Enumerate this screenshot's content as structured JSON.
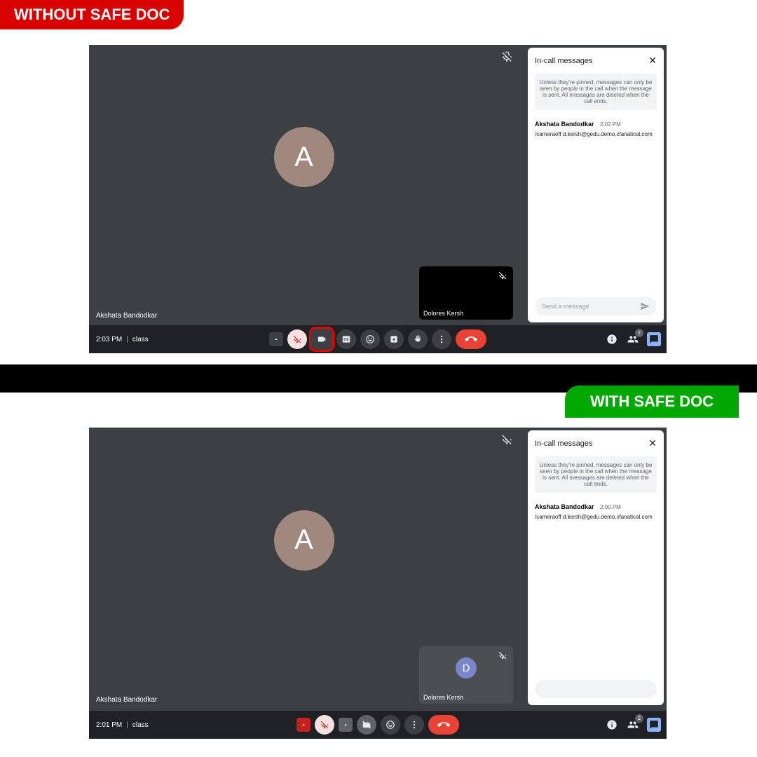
{
  "labels": {
    "without": "WITHOUT SAFE DOC",
    "with": "WITH SAFE DOC"
  },
  "shot1": {
    "avatar_letter": "A",
    "presenter": "Akshata Bandodkar",
    "self_view_name": "Dolores Kersh",
    "time": "2:03 PM",
    "room": "class",
    "chat": {
      "title": "In-call messages",
      "notice": "Unless they're pinned, messages can only be seen by people in the call when the message is sent. All messages are deleted when the call ends.",
      "author": "Akshata Bandodkar",
      "msg_time": "2:02 PM",
      "body": "/cameraoff d.kersh@gedu.demo.xfanatical.com",
      "placeholder": "Send a message"
    },
    "participants": "2"
  },
  "shot2": {
    "avatar_letter": "A",
    "presenter": "Akshata Bandodkar",
    "self_view_name": "Dolores Kersh",
    "self_avatar_letter": "D",
    "time": "2:01 PM",
    "room": "class",
    "chat": {
      "title": "In-call messages",
      "notice": "Unless they're pinned, messages can only be seen by people in the call when the message is sent. All messages are deleted when the call ends.",
      "author": "Akshata Bandodkar",
      "msg_time": "2:00 PM",
      "body": "/cameraoff d.kersh@gedu.demo.xfanatical.com",
      "placeholder": ""
    },
    "participants": "2"
  }
}
